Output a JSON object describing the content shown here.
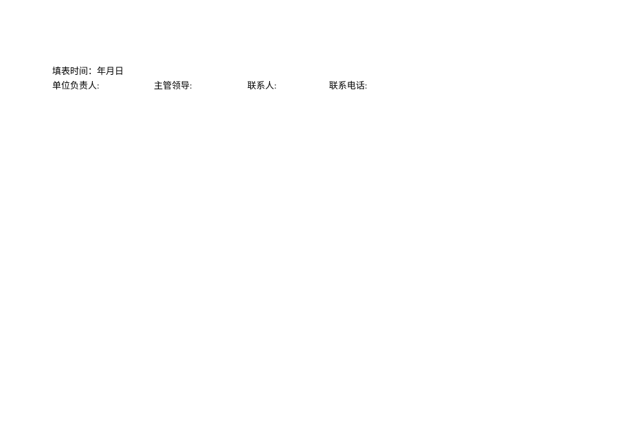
{
  "line1": {
    "text": "填表时间：年月日"
  },
  "line2": {
    "field1": "单位负责人:",
    "field2": "主管领导:",
    "field3": "联系人:",
    "field4": "联系电话:"
  }
}
